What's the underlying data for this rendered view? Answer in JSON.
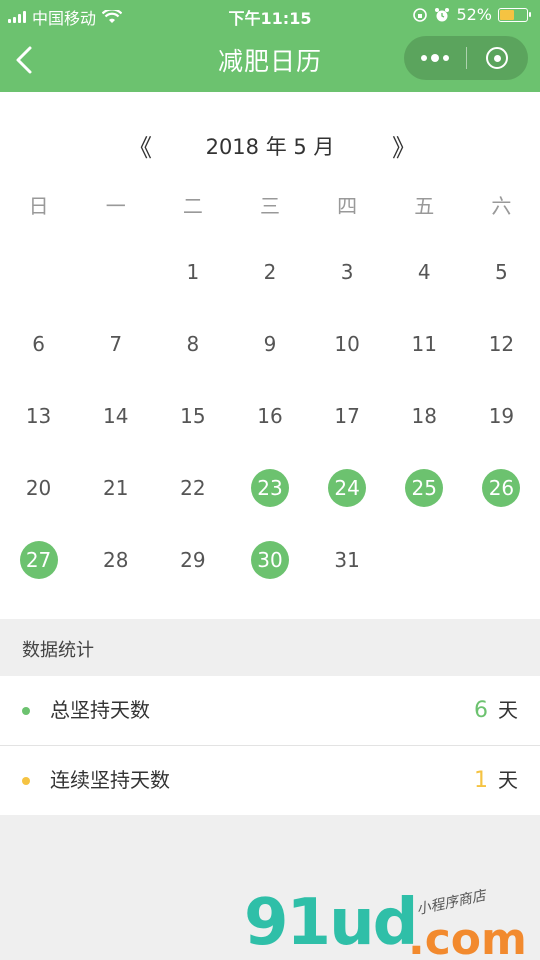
{
  "status_bar": {
    "carrier": "中国移动",
    "time": "下午11:15",
    "battery_percent": "52%",
    "battery_level": 0.52
  },
  "nav": {
    "title": "减肥日历",
    "back_icon": "chevron-left-icon",
    "more_icon": "more-dots-icon",
    "close_icon": "target-circle-icon"
  },
  "calendar": {
    "prev_symbol": "《",
    "next_symbol": "》",
    "month_label": "2018 年 5 月",
    "weekdays": [
      "日",
      "一",
      "二",
      "三",
      "四",
      "五",
      "六"
    ],
    "leading_blanks": 2,
    "days": [
      {
        "n": "1",
        "done": false
      },
      {
        "n": "2",
        "done": false
      },
      {
        "n": "3",
        "done": false
      },
      {
        "n": "4",
        "done": false
      },
      {
        "n": "5",
        "done": false
      },
      {
        "n": "6",
        "done": false
      },
      {
        "n": "7",
        "done": false
      },
      {
        "n": "8",
        "done": false
      },
      {
        "n": "9",
        "done": false
      },
      {
        "n": "10",
        "done": false
      },
      {
        "n": "11",
        "done": false
      },
      {
        "n": "12",
        "done": false
      },
      {
        "n": "13",
        "done": false
      },
      {
        "n": "14",
        "done": false
      },
      {
        "n": "15",
        "done": false
      },
      {
        "n": "16",
        "done": false
      },
      {
        "n": "17",
        "done": false
      },
      {
        "n": "18",
        "done": false
      },
      {
        "n": "19",
        "done": false
      },
      {
        "n": "20",
        "done": false
      },
      {
        "n": "21",
        "done": false
      },
      {
        "n": "22",
        "done": false
      },
      {
        "n": "23",
        "done": true
      },
      {
        "n": "24",
        "done": true
      },
      {
        "n": "25",
        "done": true
      },
      {
        "n": "26",
        "done": true
      },
      {
        "n": "27",
        "done": true
      },
      {
        "n": "28",
        "done": false
      },
      {
        "n": "29",
        "done": false
      },
      {
        "n": "30",
        "done": true
      },
      {
        "n": "31",
        "done": false
      }
    ]
  },
  "stats": {
    "section_title": "数据统计",
    "total": {
      "label": "总坚持天数",
      "value": "6",
      "unit": "天",
      "color": "#6cc26f"
    },
    "streak": {
      "label": "连续坚持天数",
      "value": "1",
      "unit": "天",
      "color": "#f5c342"
    }
  },
  "watermark": {
    "logo_text": "91ud",
    "domain_text": ".com",
    "tagline": "小程序商店"
  },
  "colors": {
    "accent": "#6cc26f",
    "streak": "#f5c342"
  }
}
